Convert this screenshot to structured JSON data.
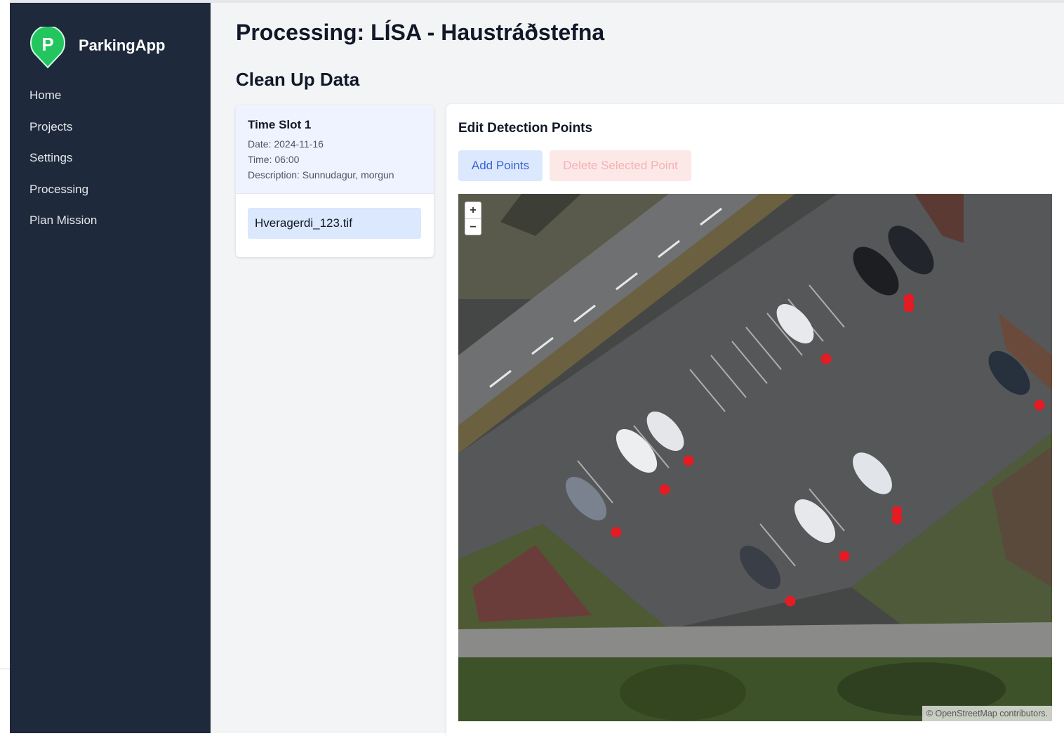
{
  "app": {
    "name": "ParkingApp",
    "logo_letter": "P",
    "brand_color": "#22c55e"
  },
  "nav": {
    "items": [
      {
        "label": "Home"
      },
      {
        "label": "Projects"
      },
      {
        "label": "Settings"
      },
      {
        "label": "Processing"
      },
      {
        "label": "Plan Mission"
      }
    ]
  },
  "page": {
    "title": "Processing: LÍSA - Haustráðstefna",
    "section_title": "Clean Up Data"
  },
  "time_slot": {
    "title": "Time Slot 1",
    "date": "Date: 2024-11-16",
    "time": "Time: 06:00",
    "description": "Description: Sunnudagur, morgun",
    "files": [
      {
        "name": "Hveragerdi_123.tif"
      }
    ]
  },
  "editor": {
    "title": "Edit Detection Points",
    "add_label": "Add Points",
    "delete_label": "Delete Selected Point",
    "zoom_in": "+",
    "zoom_out": "−",
    "attribution": "© OpenStreetMap contributors.",
    "point_color": "#e51b23",
    "map_content": "aerial-parking-lot-imagery",
    "detection_point_count": 13
  }
}
